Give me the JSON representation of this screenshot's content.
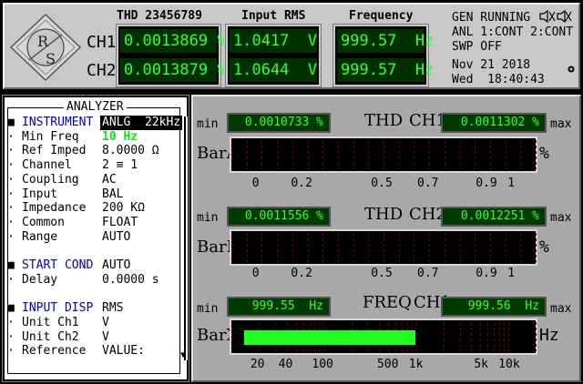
{
  "header": {
    "col_thd": "THD 23456789",
    "col_rms": "Input RMS",
    "col_freq": "Frequency",
    "ch1_label": "CH1",
    "ch2_label": "CH2",
    "ch1_thd": "0.0013869 %",
    "ch2_thd": "0.0013879 %",
    "ch1_rms": "1.0417  V",
    "ch2_rms": "1.0644  V",
    "ch1_freq": "999.57  Hz",
    "ch2_freq": "999.57  Hz",
    "status_gen": "GEN RUNNING",
    "status_anl": "ANL 1:CONT 2:CONT",
    "status_swp": "SWP OFF",
    "date": "Nov 21 2018",
    "time": "Wed  18:40:43",
    "logo_text": "R S"
  },
  "analyzer": {
    "title": "ANALYZER",
    "rows": [
      {
        "label": "INSTRUMENT",
        "value": "ANLG  22kHz",
        "kind": "section"
      },
      {
        "label": "Min Freq",
        "value": "10 Hz",
        "kind": "hl"
      },
      {
        "label": "Ref Imped",
        "value": "8.0000 Ω",
        "kind": "item"
      },
      {
        "label": "Channel",
        "value": "2 ≡ 1",
        "kind": "item"
      },
      {
        "label": "Coupling",
        "value": "AC",
        "kind": "item"
      },
      {
        "label": "Input",
        "value": "BAL",
        "kind": "item"
      },
      {
        "label": "Impedance",
        "value": "200 KΩ",
        "kind": "item"
      },
      {
        "label": "Common",
        "value": "FLOAT",
        "kind": "item"
      },
      {
        "label": "Range",
        "value": "AUTO",
        "kind": "item"
      },
      {
        "label": "",
        "value": "",
        "kind": "blank"
      },
      {
        "label": "START COND",
        "value": "AUTO",
        "kind": "section2"
      },
      {
        "label": "Delay",
        "value": "0.0000 s",
        "kind": "item"
      },
      {
        "label": "",
        "value": "",
        "kind": "blank"
      },
      {
        "label": "INPUT DISP",
        "value": "RMS",
        "kind": "section2"
      },
      {
        "label": "Unit Ch1",
        "value": "V",
        "kind": "item"
      },
      {
        "label": "Unit Ch2",
        "value": "V",
        "kind": "item"
      },
      {
        "label": "Reference",
        "value": "VALUE:",
        "kind": "item"
      }
    ]
  },
  "bars": {
    "min_label": "min",
    "max_label": "max",
    "a": {
      "title_l": "THD",
      "title_r": "CH1",
      "min": "0.0010733 %",
      "max": "0.0011302 %",
      "name": "BarA",
      "unit": "%",
      "scale": [
        "0",
        "0.2",
        "0.5",
        "0.7",
        "0.9",
        "1"
      ],
      "fill": 0.0
    },
    "b": {
      "title_l": "THD",
      "title_r": "CH2",
      "min": "0.0011556 %",
      "max": "0.0012251 %",
      "name": "BarB",
      "unit": "%",
      "scale": [
        "0",
        "0.2",
        "0.5",
        "0.7",
        "0.9",
        "1"
      ],
      "fill": 0.0
    },
    "x": {
      "title_l": "FREQ",
      "title_r": "CH1",
      "min": "999.55  Hz",
      "max": "999.56  Hz",
      "name": "BarX",
      "unit": "Hz",
      "scale": [
        "20",
        "40",
        "100",
        "500",
        "1k",
        "5k",
        "10k"
      ],
      "fill_hz": 999.57
    }
  },
  "colors": {
    "lcd_text": "#31ff31",
    "section_blue": "#0000c0",
    "highlight_green": "#22d622",
    "bar_fill": "#22ff22"
  }
}
